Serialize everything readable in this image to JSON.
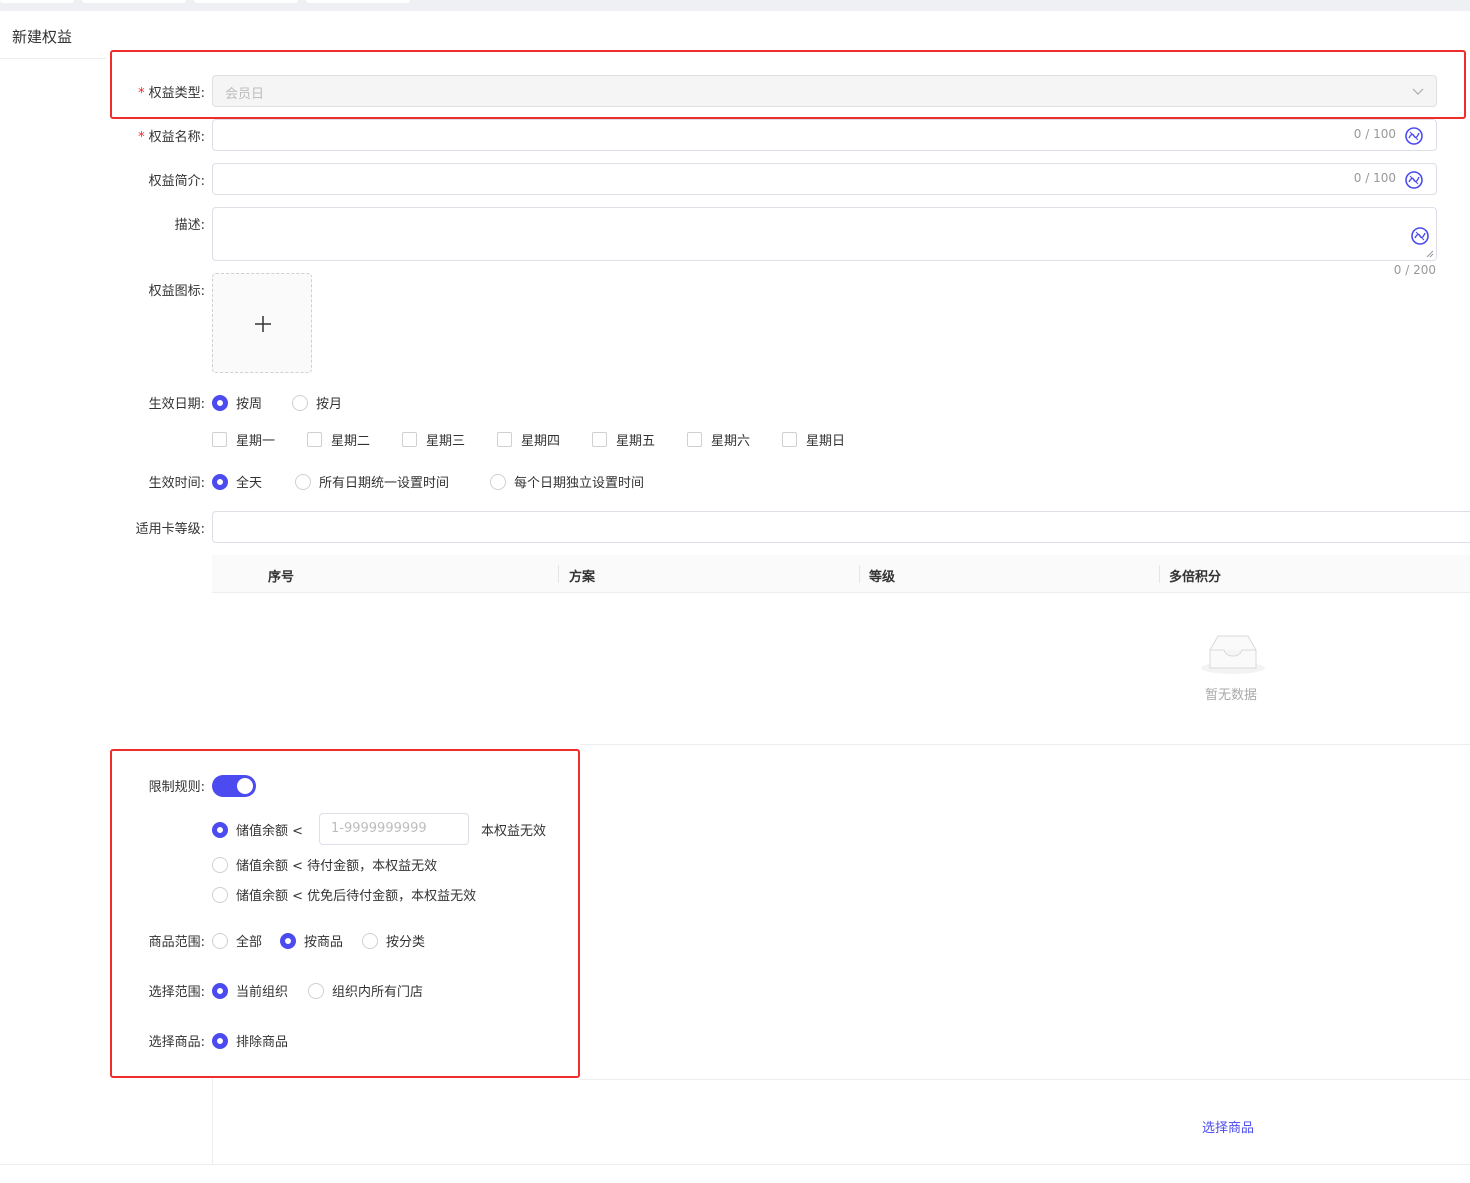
{
  "page": {
    "title": "新建权益"
  },
  "form": {
    "type": {
      "label": "权益类型:",
      "value": "会员日"
    },
    "name": {
      "label": "权益名称:",
      "count": "0 / 100"
    },
    "intro": {
      "label": "权益简介:",
      "count": "0 / 100"
    },
    "desc": {
      "label": "描述:",
      "count": "0 / 200"
    },
    "icon": {
      "label": "权益图标:"
    },
    "effective_date": {
      "label": "生效日期:",
      "options": [
        "按周",
        "按月"
      ],
      "selected": "按周",
      "weekdays": [
        "星期一",
        "星期二",
        "星期三",
        "星期四",
        "星期五",
        "星期六",
        "星期日"
      ]
    },
    "effective_time": {
      "label": "生效时间:",
      "options": [
        "全天",
        "所有日期统一设置时间",
        "每个日期独立设置时间"
      ],
      "selected": "全天"
    },
    "card_level": {
      "label": "适用卡等级:"
    },
    "table": {
      "columns": [
        "序号",
        "方案",
        "等级",
        "多倍积分"
      ],
      "empty_text": "暂无数据"
    },
    "limit_rule": {
      "label": "限制规则:",
      "enabled": true,
      "option1_prefix": "储值余额 <",
      "amount_placeholder": "1-9999999999",
      "option1_suffix": "本权益无效",
      "option2": "储值余额 < 待付金额，本权益无效",
      "option3": "储值余额 < 优免后待付金额，本权益无效"
    },
    "goods_scope": {
      "label": "商品范围:",
      "options": [
        "全部",
        "按商品",
        "按分类"
      ],
      "selected": "按商品"
    },
    "select_scope": {
      "label": "选择范围:",
      "options": [
        "当前组织",
        "组织内所有门店"
      ],
      "selected": "当前组织"
    },
    "select_goods": {
      "label": "选择商品:",
      "options": [
        "排除商品"
      ],
      "selected": "排除商品",
      "link": "选择商品"
    }
  },
  "colors": {
    "accent": "#4b4bf0",
    "required": "#f5222d",
    "highlight": "#f02d2d"
  }
}
